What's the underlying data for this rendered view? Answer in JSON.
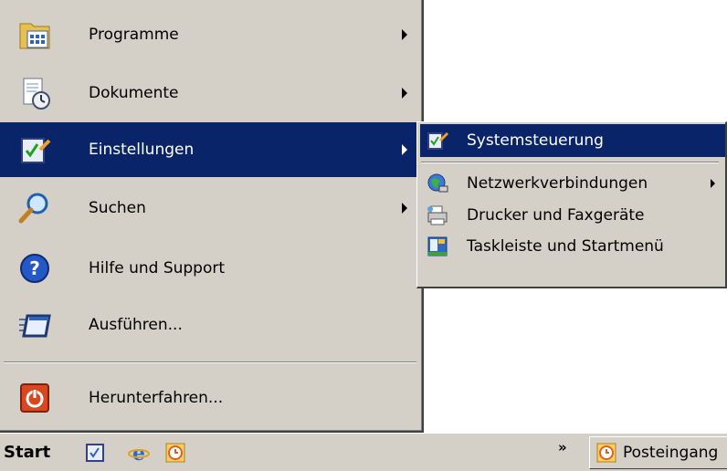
{
  "start_menu": {
    "items": [
      {
        "label": "Programme",
        "icon": "programs-folder-icon"
      },
      {
        "label": "Dokumente",
        "icon": "documents-icon"
      },
      {
        "label": "Einstellungen",
        "icon": "settings-icon"
      },
      {
        "label": "Suchen",
        "icon": "search-magnifier-icon"
      },
      {
        "label": "Hilfe und Support",
        "icon": "help-icon"
      },
      {
        "label": "Ausführen...",
        "icon": "run-icon"
      },
      {
        "label": "Herunterfahren...",
        "icon": "shutdown-icon"
      }
    ]
  },
  "settings_submenu": {
    "items": [
      {
        "label": "Systemsteuerung",
        "icon": "control-panel-icon"
      },
      {
        "label": "Netzwerkverbindungen",
        "icon": "network-connections-icon"
      },
      {
        "label": "Drucker und Faxgeräte",
        "icon": "printer-fax-icon"
      },
      {
        "label": "Taskleiste und Startmenü",
        "icon": "taskbar-startmenu-icon"
      }
    ]
  },
  "taskbar": {
    "start_label": "Start",
    "chevron": "»",
    "task_button_label": "Posteingang"
  },
  "colors": {
    "highlight": "#0a246a",
    "menu_bg": "#d4d0c8"
  }
}
